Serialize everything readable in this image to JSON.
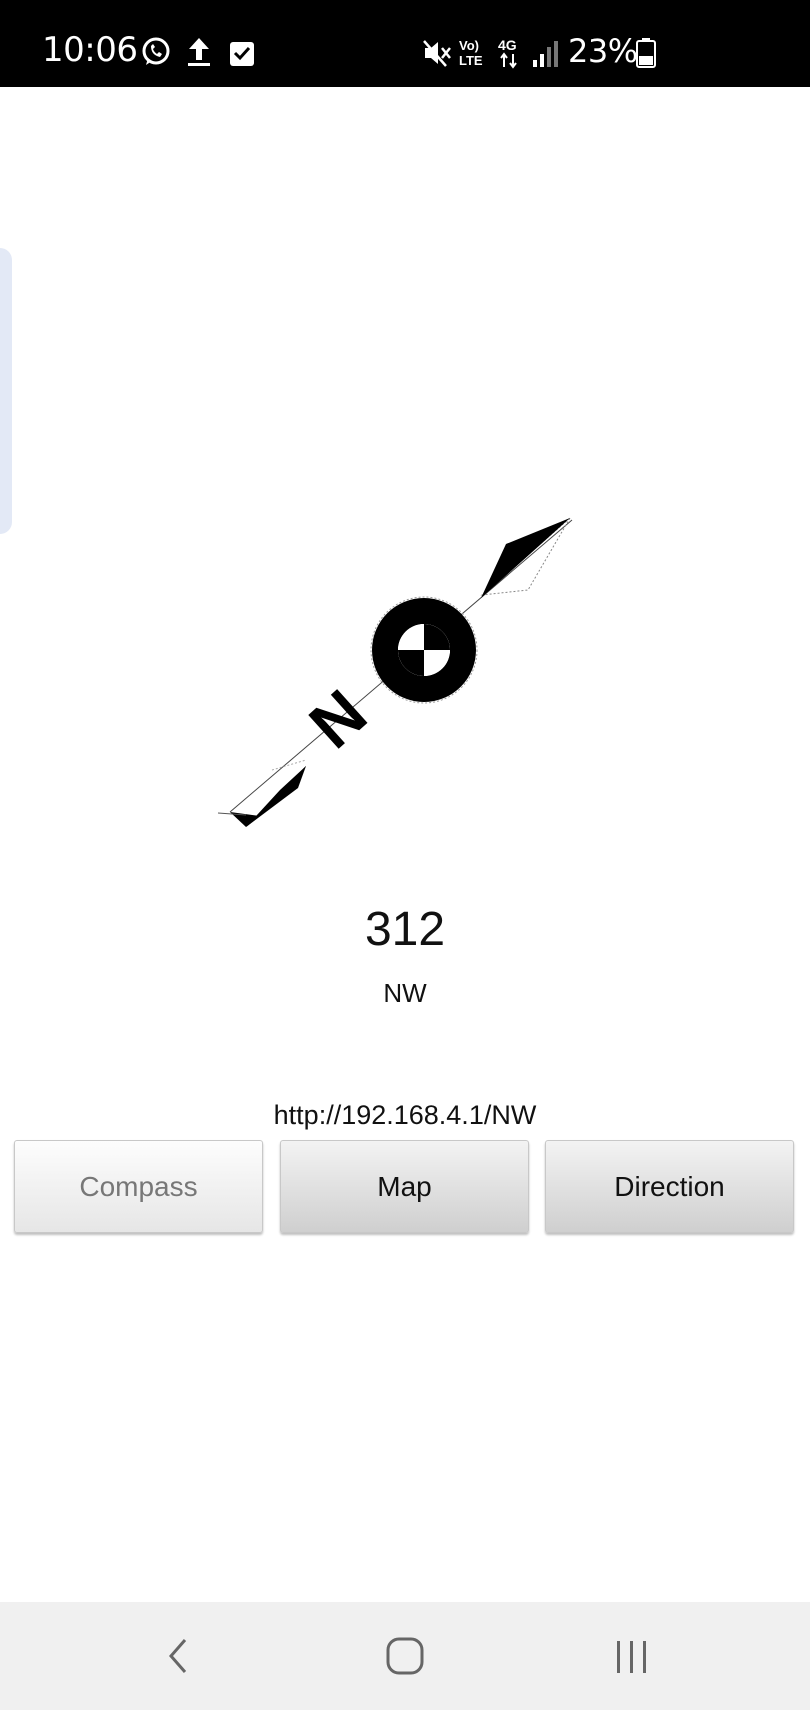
{
  "status_bar": {
    "time": "10:06",
    "battery_percent": "23%",
    "icons": [
      "whatsapp-icon",
      "upload-icon",
      "checkbox-icon",
      "mute-icon",
      "volte-icon",
      "4g-icon",
      "signal-icon",
      "battery-icon"
    ]
  },
  "compass": {
    "heading": "312",
    "direction": "NW",
    "needle_label": "N"
  },
  "url": "http://192.168.4.1/NW",
  "buttons": {
    "compass": "Compass",
    "map": "Map",
    "direction": "Direction",
    "active": "compass"
  },
  "nav_bar": {
    "icons": [
      "back-icon",
      "home-icon",
      "recents-icon"
    ]
  },
  "colors": {
    "status_bar_bg": "#000000",
    "nav_bar_bg": "#f0f0f0",
    "edge_tab": "#e3e9f6"
  }
}
